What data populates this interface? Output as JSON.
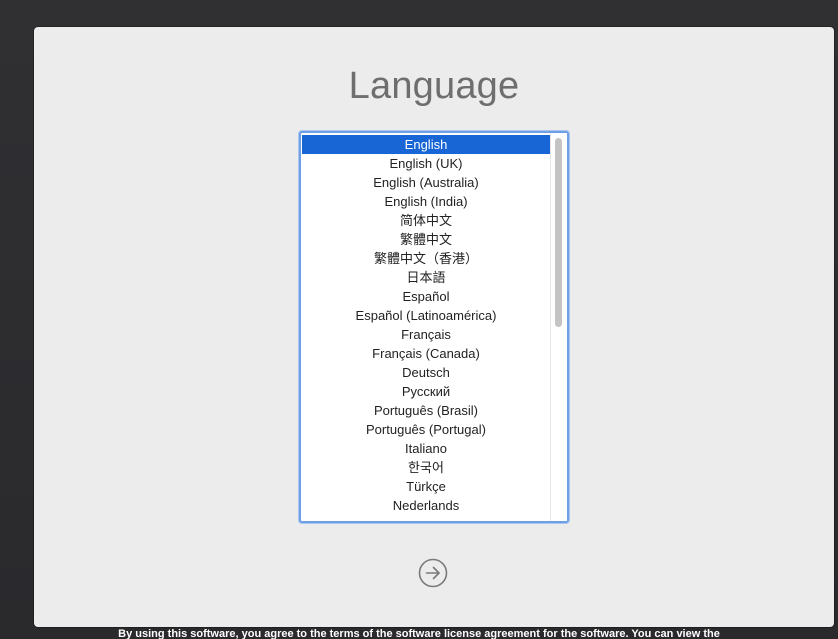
{
  "window": {
    "title": "Language"
  },
  "language_list": {
    "selected_index": 0,
    "items": [
      "English",
      "English (UK)",
      "English (Australia)",
      "English (India)",
      "简体中文",
      "繁體中文",
      "繁體中文（香港）",
      "日本語",
      "Español",
      "Español (Latinoamérica)",
      "Français",
      "Français (Canada)",
      "Deutsch",
      "Русский",
      "Português (Brasil)",
      "Português (Portugal)",
      "Italiano",
      "한국어",
      "Türkçe",
      "Nederlands"
    ],
    "scroll_position_fraction": 0.0,
    "visible_fraction": 0.5
  },
  "next_button": {
    "icon": "arrow-right-circle-icon"
  },
  "footer": {
    "license_text": "By using this software, you agree to the terms of the software license agreement for the software. You can view the"
  },
  "colors": {
    "selection": "#1866d6",
    "focus_ring": "#6fa0e6",
    "panel_background": "#ececec",
    "title_text": "#6e6e6e"
  }
}
